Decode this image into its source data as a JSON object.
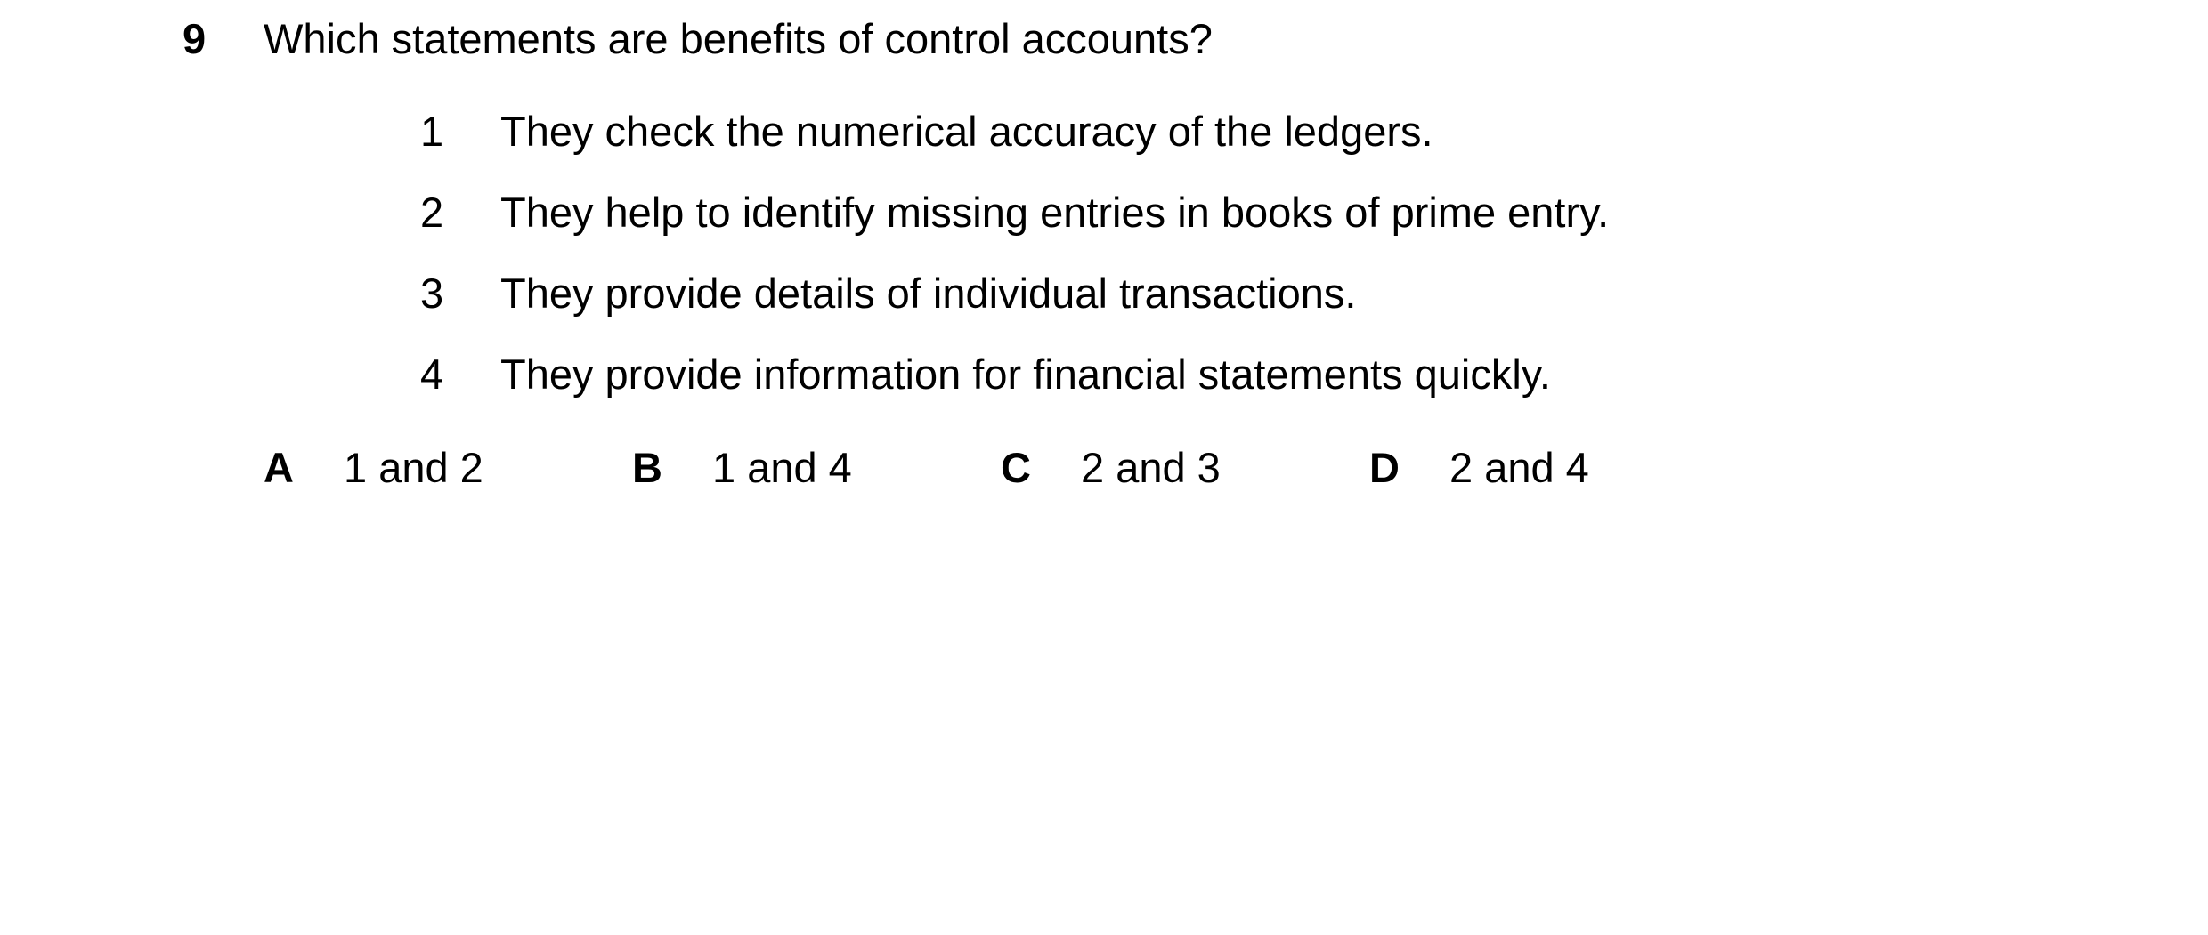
{
  "question": {
    "number": "9",
    "text": "Which statements are benefits of control accounts?"
  },
  "statements": [
    {
      "number": "1",
      "text": "They check the numerical accuracy of the ledgers."
    },
    {
      "number": "2",
      "text": "They help to identify missing entries in books of prime entry."
    },
    {
      "number": "3",
      "text": "They provide details of individual transactions."
    },
    {
      "number": "4",
      "text": "They provide information for financial statements quickly."
    }
  ],
  "options": [
    {
      "letter": "A",
      "text": "1 and 2"
    },
    {
      "letter": "B",
      "text": "1 and 4"
    },
    {
      "letter": "C",
      "text": "2 and 3"
    },
    {
      "letter": "D",
      "text": "2 and 4"
    }
  ]
}
